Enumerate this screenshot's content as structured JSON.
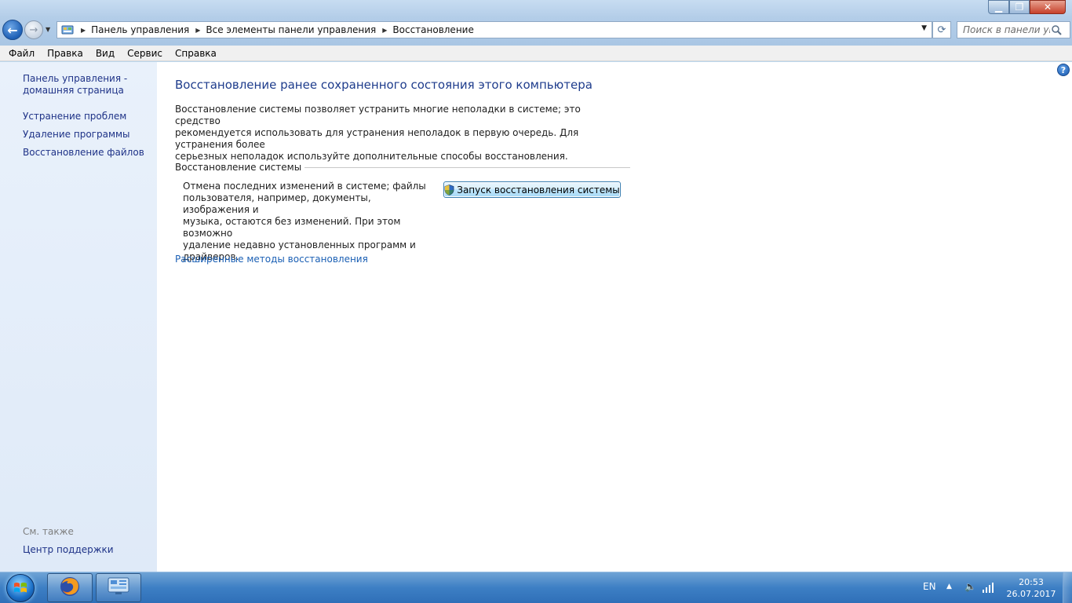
{
  "address": {
    "crumbs": [
      "Панель управления",
      "Все элементы панели управления",
      "Восстановление"
    ]
  },
  "search": {
    "placeholder": "Поиск в панели уп..."
  },
  "menu": [
    "Файл",
    "Правка",
    "Вид",
    "Сервис",
    "Справка"
  ],
  "sidebar": {
    "home_line1": "Панель управления -",
    "home_line2": "домашняя страница",
    "links": [
      "Устранение проблем",
      "Удаление программы",
      "Восстановление файлов"
    ],
    "see_also_label": "См. также",
    "see_also_link": "Центр поддержки"
  },
  "main": {
    "title": "Восстановление ранее сохраненного состояния этого компьютера",
    "intro_line1": "Восстановление системы позволяет устранить многие неполадки в системе; это средство",
    "intro_line2": "рекомендуется использовать для устранения неполадок в первую очередь. Для устранения более",
    "intro_line3": "серьезных неполадок используйте дополнительные способы восстановления.",
    "section_label": "Восстановление системы",
    "section_desc_line1": "Отмена последних изменений в системе; файлы",
    "section_desc_line2": "пользователя, например, документы, изображения и",
    "section_desc_line3": "музыка, остаются без изменений. При этом возможно",
    "section_desc_line4": "удаление недавно установленных программ и",
    "section_desc_line5": "драйверов.",
    "restore_button": "Запуск восстановления системы",
    "advanced_link": "Расширенные методы восстановления"
  },
  "taskbar": {
    "language": "EN",
    "time": "20:53",
    "date": "26.07.2017"
  },
  "icons": {
    "back": "back-arrow-icon",
    "forward": "forward-arrow-icon",
    "control_panel": "control-panel-icon",
    "refresh": "refresh-icon",
    "search": "search-icon",
    "help": "help-icon",
    "shield": "uac-shield-icon",
    "firefox": "firefox-icon",
    "volume": "speaker-icon",
    "network": "signal-bars-icon"
  },
  "colors": {
    "link": "#1e3287",
    "title": "#1e3c8c",
    "accent_link": "#1a5fb4",
    "taskbar": "#3d7fc4"
  }
}
